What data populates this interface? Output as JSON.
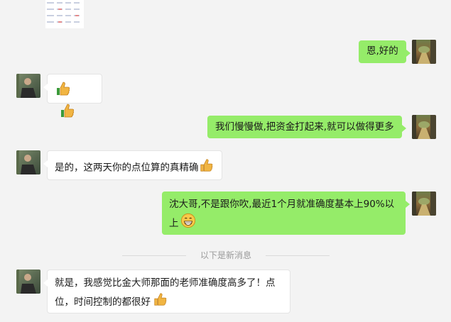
{
  "chat": {
    "messages": [
      {
        "side": "out",
        "text": "恩,好的",
        "emoji": []
      },
      {
        "side": "in",
        "text": "",
        "emoji": [
          "thumbs-up",
          "thumbs-up"
        ]
      },
      {
        "side": "out",
        "text": "我们慢慢做,把资金打起来,就可以做得更多",
        "emoji": []
      },
      {
        "side": "in",
        "text": "是的，这两天你的点位算的真精确",
        "emoji": [
          "thumbs-up"
        ]
      },
      {
        "side": "out",
        "text_line1": "沈大哥,不是跟你吹,最近1个月就准确度基本上90%以",
        "text_line2": "上",
        "emoji": [
          "grin"
        ]
      },
      {
        "side": "in",
        "text_line1": "就是，我感觉比金大师那面的老师准确度高多了！点",
        "text_line2": "位，时间控制的都很好",
        "emoji": [
          "thumbs-up"
        ]
      }
    ],
    "divider": "以下是新消息"
  },
  "colors": {
    "bubble_out": "#95ec69",
    "bubble_in": "#ffffff",
    "background": "#f3f3f3"
  }
}
